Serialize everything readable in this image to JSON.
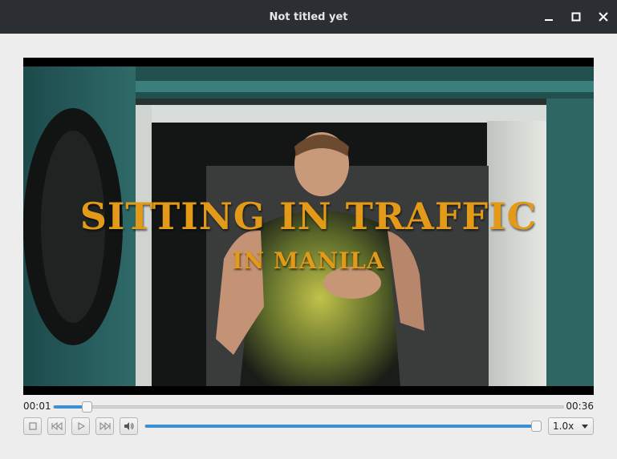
{
  "window": {
    "title": "Not titled yet",
    "controls": [
      "minimize-icon",
      "maximize-icon",
      "close-icon"
    ]
  },
  "video": {
    "caption_main": "SITTING IN TRAFFIC",
    "caption_sub": "IN MANILA",
    "caption_color": "#e39a18"
  },
  "playback": {
    "current_time": "00:01",
    "duration": "00:36",
    "progress_fraction": 0.064
  },
  "controls": {
    "buttons": [
      "stop-icon",
      "skip-back-icon",
      "play-icon",
      "skip-forward-icon",
      "volume-icon"
    ],
    "volume_fraction": 0.985,
    "speed": "1.0x"
  },
  "colors": {
    "titlebar": "#2b2f33",
    "accent": "#3d8fd4",
    "background": "#ededed"
  }
}
